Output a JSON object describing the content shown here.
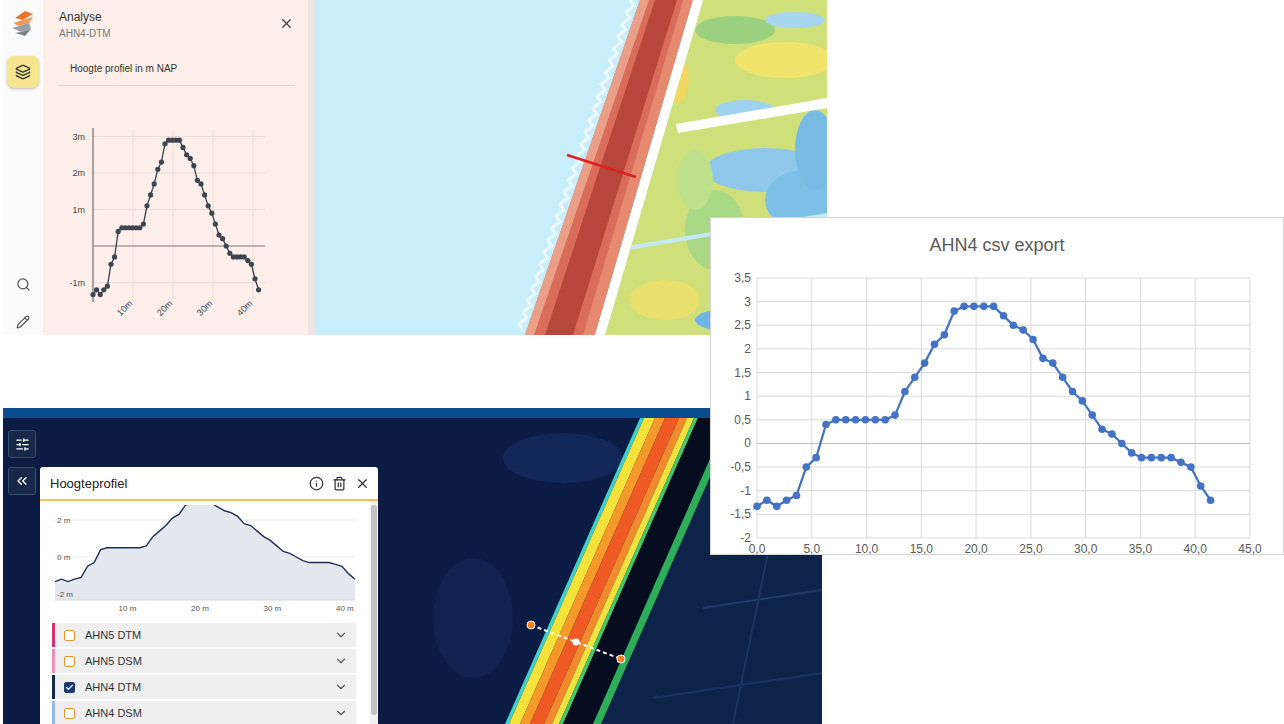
{
  "analysis_app": {
    "panel": {
      "title": "Analyse",
      "subtitle": "AHN4-DTM"
    },
    "chart": {
      "title": "Hoogte profiel in m NAP",
      "y_ticks": [
        {
          "label": "3m",
          "value": 3
        },
        {
          "label": "2m",
          "value": 2
        },
        {
          "label": "1m",
          "value": 1
        },
        {
          "label": "-1m",
          "value": -1
        }
      ],
      "x_ticks": [
        {
          "label": "10m",
          "value": 10
        },
        {
          "label": "20m",
          "value": 20
        },
        {
          "label": "30m",
          "value": 30
        },
        {
          "label": "40m",
          "value": 40
        }
      ],
      "values": [
        -1.33,
        -1.2,
        -1.33,
        -1.2,
        -1.1,
        -0.5,
        -0.3,
        0.4,
        0.5,
        0.5,
        0.5,
        0.5,
        0.5,
        0.5,
        0.6,
        1.1,
        1.4,
        1.7,
        2.1,
        2.3,
        2.8,
        2.9,
        2.9,
        2.9,
        2.9,
        2.7,
        2.5,
        2.4,
        2.2,
        1.8,
        1.7,
        1.4,
        1.1,
        0.9,
        0.6,
        0.3,
        0.2,
        0.0,
        -0.2,
        -0.3,
        -0.3,
        -0.3,
        -0.3,
        -0.4,
        -0.5,
        -0.9,
        -1.2
      ]
    }
  },
  "csv_chart": {
    "title": "AHN4 csv export",
    "y_ticks": [
      {
        "label": "3,5",
        "value": 3.5
      },
      {
        "label": "3",
        "value": 3
      },
      {
        "label": "2,5",
        "value": 2.5
      },
      {
        "label": "2",
        "value": 2
      },
      {
        "label": "1,5",
        "value": 1.5
      },
      {
        "label": "1",
        "value": 1
      },
      {
        "label": "0,5",
        "value": 0.5
      },
      {
        "label": "0",
        "value": 0
      },
      {
        "label": "-0,5",
        "value": -0.5
      },
      {
        "label": "-1",
        "value": -1
      },
      {
        "label": "-1,5",
        "value": -1.5
      },
      {
        "label": "-2",
        "value": -2
      }
    ],
    "x_ticks": [
      {
        "label": "0,0",
        "value": 0
      },
      {
        "label": "5,0",
        "value": 5
      },
      {
        "label": "10,0",
        "value": 10
      },
      {
        "label": "15,0",
        "value": 15
      },
      {
        "label": "20,0",
        "value": 20
      },
      {
        "label": "25,0",
        "value": 25
      },
      {
        "label": "30,0",
        "value": 30
      },
      {
        "label": "35,0",
        "value": 35
      },
      {
        "label": "40,0",
        "value": 40
      },
      {
        "label": "45,0",
        "value": 45
      }
    ],
    "series": {
      "distance": [
        0,
        0.9,
        1.8,
        2.7,
        3.6,
        4.5,
        5.4,
        6.3,
        7.2,
        8.1,
        9,
        9.9,
        10.8,
        11.7,
        12.6,
        13.5,
        14.4,
        15.3,
        16.2,
        17.1,
        18,
        18.9,
        19.8,
        20.7,
        21.6,
        22.5,
        23.4,
        24.3,
        25.2,
        26.1,
        27,
        27.9,
        28.8,
        29.7,
        30.6,
        31.5,
        32.4,
        33.3,
        34.2,
        35.1,
        36,
        36.9,
        37.8,
        38.7,
        39.6,
        40.5,
        41.4
      ],
      "height": [
        -1.33,
        -1.2,
        -1.33,
        -1.2,
        -1.1,
        -0.5,
        -0.3,
        0.4,
        0.5,
        0.5,
        0.5,
        0.5,
        0.5,
        0.5,
        0.6,
        1.1,
        1.4,
        1.7,
        2.1,
        2.3,
        2.8,
        2.9,
        2.9,
        2.9,
        2.9,
        2.7,
        2.5,
        2.4,
        2.2,
        1.8,
        1.7,
        1.4,
        1.1,
        0.9,
        0.6,
        0.3,
        0.2,
        0.0,
        -0.2,
        -0.3,
        -0.3,
        -0.3,
        -0.3,
        -0.4,
        -0.5,
        -0.9,
        -1.2
      ]
    }
  },
  "profile_app": {
    "panel": {
      "title": "Hoogteprofiel"
    },
    "chart": {
      "y_ticks": [
        {
          "label": "2 m",
          "value": 2
        },
        {
          "label": "0 m",
          "value": 0
        },
        {
          "label": "-2 m",
          "value": -2
        }
      ],
      "x_ticks": [
        {
          "label": "10 m",
          "value": 10
        },
        {
          "label": "20 m",
          "value": 20
        },
        {
          "label": "30 m",
          "value": 30
        },
        {
          "label": "40 m",
          "value": 40
        }
      ],
      "values": [
        -1.33,
        -1.2,
        -1.33,
        -1.2,
        -1.1,
        -0.5,
        -0.3,
        0.4,
        0.5,
        0.5,
        0.5,
        0.5,
        0.5,
        0.5,
        0.6,
        1.1,
        1.4,
        1.7,
        2.1,
        2.3,
        2.8,
        2.9,
        2.9,
        2.9,
        2.9,
        2.7,
        2.5,
        2.4,
        2.2,
        1.8,
        1.7,
        1.4,
        1.1,
        0.9,
        0.6,
        0.3,
        0.2,
        0.0,
        -0.2,
        -0.3,
        -0.3,
        -0.3,
        -0.3,
        -0.4,
        -0.5,
        -0.9,
        -1.2
      ]
    },
    "layers": [
      {
        "label": "AHN5 DTM",
        "checked": false,
        "color": "#d6336c"
      },
      {
        "label": "AHN5 DSM",
        "checked": false,
        "color": "#ef8fb3"
      },
      {
        "label": "AHN4 DTM",
        "checked": true,
        "color": "#14284f"
      },
      {
        "label": "AHN4 DSM",
        "checked": false,
        "color": "#8fb9e6"
      }
    ]
  }
}
